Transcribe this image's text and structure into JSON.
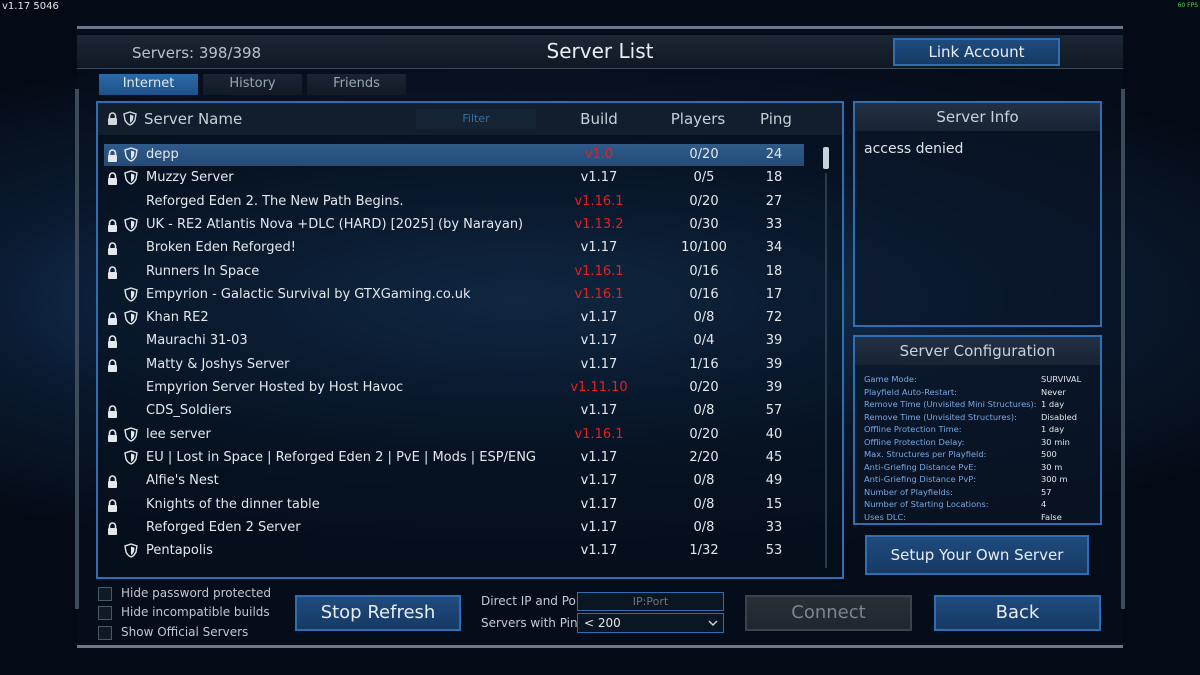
{
  "corner": {
    "version": "v1.17 5046",
    "fps": "60 FPS"
  },
  "header": {
    "servers": "Servers: 398/398",
    "title": "Server List",
    "link_account": "Link Account"
  },
  "tabs": [
    {
      "label": "Internet",
      "active": true
    },
    {
      "label": "History",
      "active": false
    },
    {
      "label": "Friends",
      "active": false
    }
  ],
  "list": {
    "columns": {
      "name": "Server Name",
      "filter": "Filter",
      "build": "Build",
      "players": "Players",
      "ping": "Ping"
    },
    "rows": [
      {
        "lock": true,
        "shield": true,
        "name": "depp",
        "build": "v1.0",
        "build_bad": true,
        "players": "0/20",
        "ping": "24",
        "selected": true
      },
      {
        "lock": true,
        "shield": true,
        "name": "Muzzy Server",
        "build": "v1.17",
        "build_bad": false,
        "players": "0/5",
        "ping": "18"
      },
      {
        "lock": false,
        "shield": false,
        "name": "Reforged Eden 2. The New Path Begins.",
        "build": "v1.16.1",
        "build_bad": true,
        "players": "0/20",
        "ping": "27"
      },
      {
        "lock": true,
        "shield": true,
        "name": "UK - RE2 Atlantis Nova +DLC (HARD) [2025] (by Narayan)",
        "build": "v1.13.2",
        "build_bad": true,
        "players": "0/30",
        "ping": "33"
      },
      {
        "lock": true,
        "shield": false,
        "name": "Broken Eden Reforged!",
        "build": "v1.17",
        "build_bad": false,
        "players": "10/100",
        "ping": "34"
      },
      {
        "lock": true,
        "shield": false,
        "name": "Runners In Space",
        "build": "v1.16.1",
        "build_bad": true,
        "players": "0/16",
        "ping": "18"
      },
      {
        "lock": false,
        "shield": true,
        "name": "Empyrion - Galactic Survival by GTXGaming.co.uk",
        "build": "v1.16.1",
        "build_bad": true,
        "players": "0/16",
        "ping": "17"
      },
      {
        "lock": true,
        "shield": true,
        "name": "Khan RE2",
        "build": "v1.17",
        "build_bad": false,
        "players": "0/8",
        "ping": "72"
      },
      {
        "lock": true,
        "shield": false,
        "name": "Maurachi 31-03",
        "build": "v1.17",
        "build_bad": false,
        "players": "0/4",
        "ping": "39"
      },
      {
        "lock": true,
        "shield": false,
        "name": "Matty & Joshys Server",
        "build": "v1.17",
        "build_bad": false,
        "players": "1/16",
        "ping": "39"
      },
      {
        "lock": false,
        "shield": false,
        "name": "Empyrion Server Hosted by Host Havoc",
        "build": "v1.11.10",
        "build_bad": true,
        "players": "0/20",
        "ping": "39"
      },
      {
        "lock": true,
        "shield": false,
        "name": "CDS_Soldiers",
        "build": "v1.17",
        "build_bad": false,
        "players": "0/8",
        "ping": "57"
      },
      {
        "lock": true,
        "shield": true,
        "name": "lee server",
        "build": "v1.16.1",
        "build_bad": true,
        "players": "0/20",
        "ping": "40"
      },
      {
        "lock": false,
        "shield": true,
        "name": "EU | Lost in Space | Reforged Eden 2 | PvE | Mods | ESP/ENG",
        "build": "v1.17",
        "build_bad": false,
        "players": "2/20",
        "ping": "45"
      },
      {
        "lock": true,
        "shield": false,
        "name": "Alfie's Nest",
        "build": "v1.17",
        "build_bad": false,
        "players": "0/8",
        "ping": "49"
      },
      {
        "lock": true,
        "shield": false,
        "name": "Knights of the dinner table",
        "build": "v1.17",
        "build_bad": false,
        "players": "0/8",
        "ping": "15"
      },
      {
        "lock": true,
        "shield": false,
        "name": "Reforged Eden 2 Server",
        "build": "v1.17",
        "build_bad": false,
        "players": "0/8",
        "ping": "33"
      },
      {
        "lock": false,
        "shield": true,
        "name": "Pentapolis",
        "build": "v1.17",
        "build_bad": false,
        "players": "1/32",
        "ping": "53"
      }
    ]
  },
  "server_info": {
    "title": "Server Info",
    "text": "access denied"
  },
  "server_config": {
    "title": "Server Configuration",
    "items": [
      {
        "key": "Game Mode:",
        "value": "SURVIVAL"
      },
      {
        "key": "Playfield Auto-Restart:",
        "value": "Never"
      },
      {
        "key": "Remove Time (Unvisited Mini Structures):",
        "value": "1 day"
      },
      {
        "key": "Remove Time (Unvisited Structures):",
        "value": "Disabled"
      },
      {
        "key": "Offline Protection Time:",
        "value": "1 day"
      },
      {
        "key": "Offline Protection Delay:",
        "value": "30 min"
      },
      {
        "key": "Max. Structures per Playfield:",
        "value": "500"
      },
      {
        "key": "Anti-Griefing Distance PvE:",
        "value": "30 m"
      },
      {
        "key": "Anti-Griefing Distance PvP:",
        "value": "300 m"
      },
      {
        "key": "Number of Playfields:",
        "value": "57"
      },
      {
        "key": "Number of Starting Locations:",
        "value": "4"
      },
      {
        "key": "Uses DLC:",
        "value": "False"
      }
    ]
  },
  "setup_button": "Setup Your Own Server",
  "filters": [
    {
      "label": "Hide password protected",
      "checked": false
    },
    {
      "label": "Hide incompatible builds",
      "checked": false
    },
    {
      "label": "Show Official Servers",
      "checked": false
    }
  ],
  "bottom": {
    "stop_refresh": "Stop Refresh",
    "direct_ip_label": "Direct IP and Port:",
    "ip_placeholder": "IP:Port",
    "ping_label": "Servers with Ping:",
    "ping_value": "< 200",
    "connect": "Connect",
    "back": "Back"
  },
  "colors": {
    "accent": "#2f6fb1",
    "bad_build": "#e52020",
    "selected_row": "#2f5a8a"
  }
}
